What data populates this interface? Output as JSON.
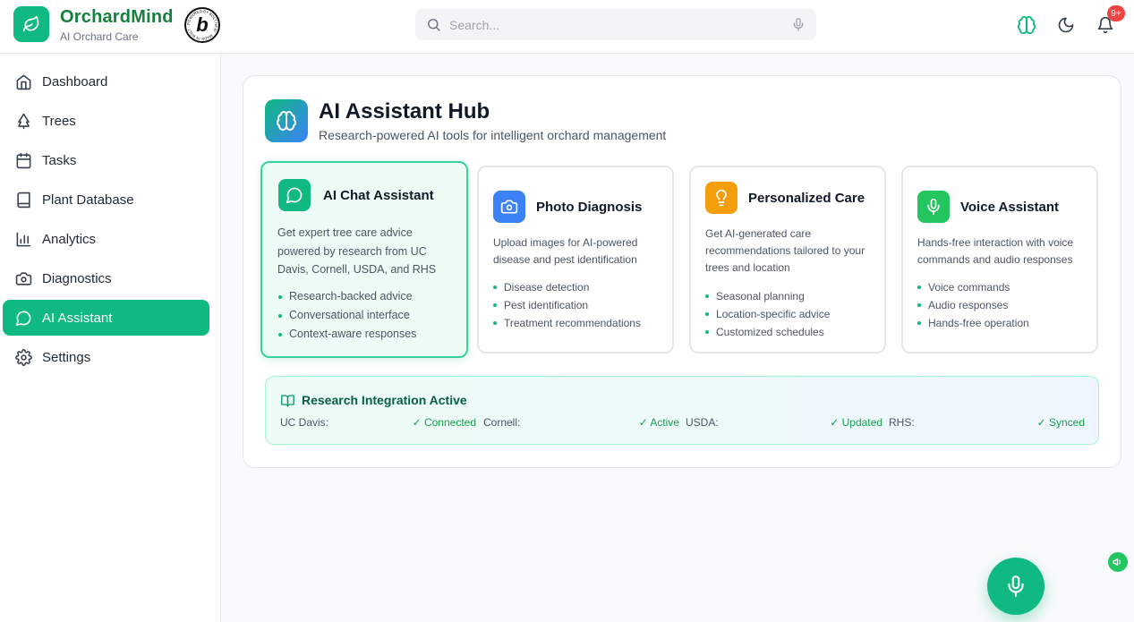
{
  "app": {
    "name": "OrchardMind",
    "subtitle": "AI Orchard Care",
    "badge_letter": "b",
    "badge_ring_text": "POWERED BY BOLT.NEW · MADE IN BOLT ·"
  },
  "search": {
    "placeholder": "Search..."
  },
  "header": {
    "notification_count": "9+"
  },
  "sidebar": {
    "items": [
      {
        "label": "Dashboard",
        "icon": "home-icon"
      },
      {
        "label": "Trees",
        "icon": "tree-icon"
      },
      {
        "label": "Tasks",
        "icon": "calendar-icon"
      },
      {
        "label": "Plant Database",
        "icon": "book-icon"
      },
      {
        "label": "Analytics",
        "icon": "bar-chart-icon"
      },
      {
        "label": "Diagnostics",
        "icon": "camera-icon"
      },
      {
        "label": "AI Assistant",
        "icon": "chat-icon",
        "active": true
      },
      {
        "label": "Settings",
        "icon": "gear-icon"
      }
    ]
  },
  "hub": {
    "title": "AI Assistant Hub",
    "subtitle": "Research-powered AI tools for intelligent orchard management"
  },
  "cards": [
    {
      "title": "AI Chat Assistant",
      "icon": "chat-icon",
      "color": "#10b981",
      "description": "Get expert tree care advice powered by research from UC Davis, Cornell, USDA, and RHS",
      "features": [
        "Research-backed advice",
        "Conversational interface",
        "Context-aware responses"
      ]
    },
    {
      "title": "Photo Diagnosis",
      "icon": "camera-icon",
      "color": "#3b82f6",
      "description": "Upload images for AI-powered disease and pest identification",
      "features": [
        "Disease detection",
        "Pest identification",
        "Treatment recommendations"
      ]
    },
    {
      "title": "Personalized Care",
      "icon": "lightbulb-icon",
      "color": "#f59e0b",
      "description": "Get AI-generated care recommendations tailored to your trees and location",
      "features": [
        "Seasonal planning",
        "Location-specific advice",
        "Customized schedules"
      ]
    },
    {
      "title": "Voice Assistant",
      "icon": "mic-icon",
      "color": "#22c55e",
      "description": "Hands-free interaction with voice commands and audio responses",
      "features": [
        "Voice commands",
        "Audio responses",
        "Hands-free operation"
      ]
    }
  ],
  "research": {
    "title": "Research Integration Active",
    "sources": [
      {
        "name": "UC Davis:",
        "status": "✓ Connected"
      },
      {
        "name": "Cornell:",
        "status": "✓ Active"
      },
      {
        "name": "USDA:",
        "status": "✓ Updated"
      },
      {
        "name": "RHS:",
        "status": "✓ Synced"
      }
    ]
  },
  "colors": {
    "brand": "#15803d",
    "accent": "#10b981",
    "alert": "#ef4444"
  }
}
